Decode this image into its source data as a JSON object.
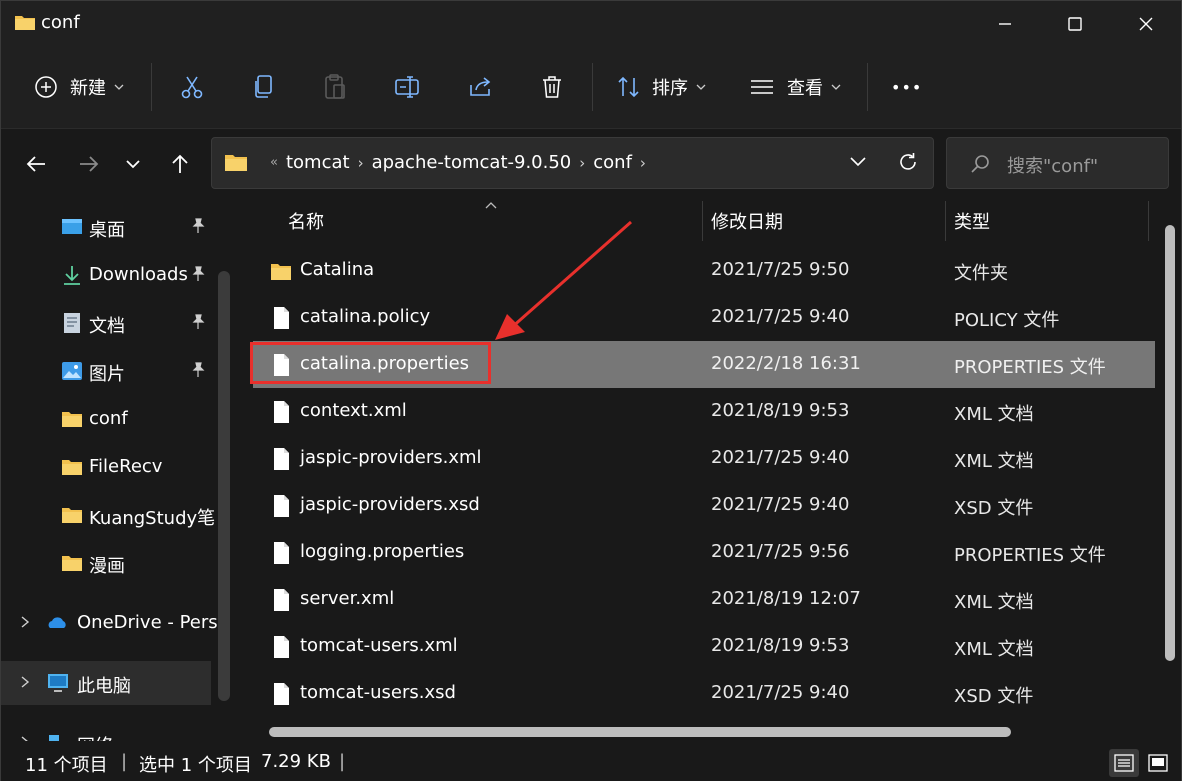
{
  "window": {
    "title": "conf",
    "controls": [
      "minimize-icon",
      "maximize-icon",
      "close-icon"
    ]
  },
  "toolbar": {
    "new_label": "新建",
    "sort_label": "排序",
    "view_label": "查看",
    "more_label": "•••"
  },
  "address": {
    "overflow": "«",
    "crumbs": [
      "tomcat",
      "apache-tomcat-9.0.50",
      "conf"
    ]
  },
  "search": {
    "placeholder": "搜索\"conf\""
  },
  "sidebar": {
    "items": [
      {
        "label": "桌面",
        "icon": "desktop-icon",
        "pinned": true
      },
      {
        "label": "Downloads",
        "icon": "download-icon",
        "pinned": true
      },
      {
        "label": "文档",
        "icon": "document-icon",
        "pinned": true
      },
      {
        "label": "图片",
        "icon": "picture-icon",
        "pinned": true
      },
      {
        "label": "conf",
        "icon": "folder-icon",
        "pinned": false
      },
      {
        "label": "FileRecv",
        "icon": "folder-icon",
        "pinned": false
      },
      {
        "label": "KuangStudy笔",
        "icon": "folder-icon",
        "pinned": false
      },
      {
        "label": "漫画",
        "icon": "folder-icon",
        "pinned": false
      },
      {
        "label": "OneDrive - Pers",
        "icon": "onedrive-icon",
        "pinned": false
      },
      {
        "label": "此电脑",
        "icon": "computer-icon",
        "pinned": false
      },
      {
        "label": "网络",
        "icon": "network-icon",
        "pinned": false
      }
    ]
  },
  "columns": {
    "name": "名称",
    "date": "修改日期",
    "type": "类型"
  },
  "files": [
    {
      "name": "Catalina",
      "date": "2021/7/25 9:50",
      "type": "文件夹",
      "kind": "folder"
    },
    {
      "name": "catalina.policy",
      "date": "2021/7/25 9:40",
      "type": "POLICY 文件",
      "kind": "file"
    },
    {
      "name": "catalina.properties",
      "date": "2022/2/18 16:31",
      "type": "PROPERTIES 文件",
      "kind": "file",
      "selected": true
    },
    {
      "name": "context.xml",
      "date": "2021/8/19 9:53",
      "type": "XML 文档",
      "kind": "file"
    },
    {
      "name": "jaspic-providers.xml",
      "date": "2021/7/25 9:40",
      "type": "XML 文档",
      "kind": "file"
    },
    {
      "name": "jaspic-providers.xsd",
      "date": "2021/7/25 9:40",
      "type": "XSD 文件",
      "kind": "file"
    },
    {
      "name": "logging.properties",
      "date": "2021/7/25 9:56",
      "type": "PROPERTIES 文件",
      "kind": "file"
    },
    {
      "name": "server.xml",
      "date": "2021/8/19 12:07",
      "type": "XML 文档",
      "kind": "file"
    },
    {
      "name": "tomcat-users.xml",
      "date": "2021/8/19 9:53",
      "type": "XML 文档",
      "kind": "file"
    },
    {
      "name": "tomcat-users.xsd",
      "date": "2021/7/25 9:40",
      "type": "XSD 文件",
      "kind": "file"
    }
  ],
  "status": {
    "count": "11 个项目",
    "selection": "选中 1 个项目",
    "size": "7.29 KB",
    "sep": "|"
  },
  "colors": {
    "background": "#191919",
    "selected_row": "#777777",
    "annotation": "#e8302c",
    "folder": "#f2c14e"
  }
}
